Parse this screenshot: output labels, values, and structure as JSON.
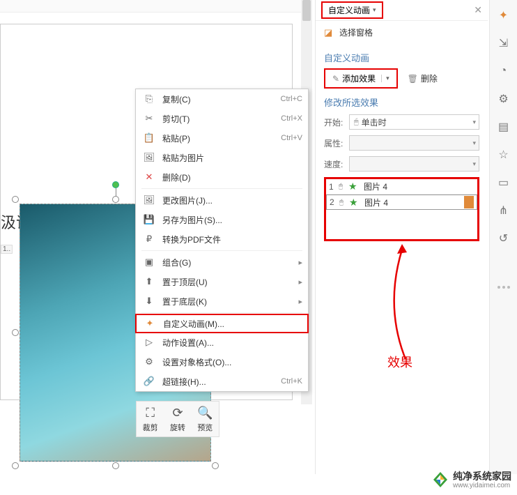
{
  "panel": {
    "title": "自定义动画",
    "selectPane": "选择窗格",
    "customAnim": "自定义动画",
    "addEffect": "添加效果",
    "deleteLabel": "删除",
    "modifyLabel": "修改所选效果",
    "startLabel": "开始:",
    "startValue": "单击时",
    "propLabel": "属性:",
    "speedLabel": "速度:"
  },
  "effects": [
    {
      "num": "1",
      "name": "图片 4"
    },
    {
      "num": "2",
      "name": "图片 4"
    }
  ],
  "annotation": "效果",
  "slide": {
    "title": "汲误工具误啊",
    "num": "1.."
  },
  "contextMenu": {
    "copy": {
      "label": "复制(C)",
      "shortcut": "Ctrl+C"
    },
    "cut": {
      "label": "剪切(T)",
      "shortcut": "Ctrl+X"
    },
    "paste": {
      "label": "粘贴(P)",
      "shortcut": "Ctrl+V"
    },
    "pasteAsPic": {
      "label": "粘贴为图片"
    },
    "delete": {
      "label": "删除(D)"
    },
    "changePic": {
      "label": "更改图片(J)..."
    },
    "saveAsPic": {
      "label": "另存为图片(S)..."
    },
    "toPdf": {
      "label": "转换为PDF文件"
    },
    "group": {
      "label": "组合(G)"
    },
    "bringFront": {
      "label": "置于顶层(U)"
    },
    "sendBack": {
      "label": "置于底层(K)"
    },
    "customAnim": {
      "label": "自定义动画(M)..."
    },
    "actionSettings": {
      "label": "动作设置(A)..."
    },
    "formatObject": {
      "label": "设置对象格式(O)..."
    },
    "hyperlink": {
      "label": "超链接(H)...",
      "shortcut": "Ctrl+K"
    }
  },
  "imgToolbar": {
    "crop": "裁剪",
    "rotate": "旋转",
    "preview": "预览"
  },
  "watermark": {
    "name": "纯净系统家园",
    "url": "www.yidaimei.com"
  }
}
